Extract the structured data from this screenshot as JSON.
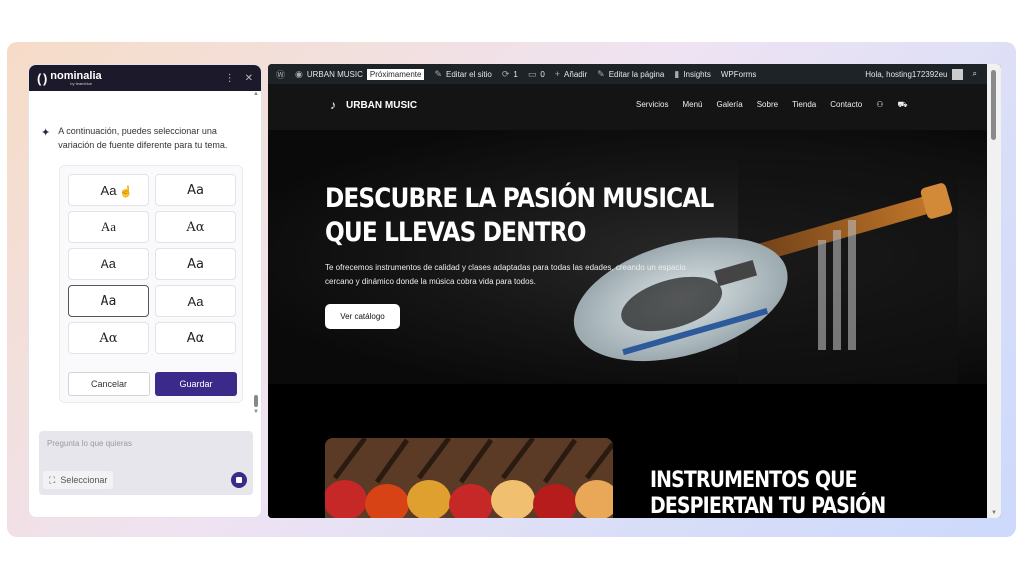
{
  "panel": {
    "brand": "nominalia",
    "brand_sub": "by teamblue",
    "menu_icon": "more-vertical-icon",
    "close_icon": "close-icon",
    "hint": "A continuación, puedes seleccionar una variación de fuente diferente para tu tema.",
    "font_options": [
      "Aa",
      "Aa",
      "Aa",
      "Aα",
      "Aa",
      "Aa",
      "Aa",
      "Aa",
      "Aα",
      "Aα"
    ],
    "selected_index": 6,
    "cancel_label": "Cancelar",
    "save_label": "Guardar",
    "chat_placeholder": "Pregunta lo que quieras",
    "select_label": "Seleccionar"
  },
  "adminbar": {
    "site_name": "URBAN MUSIC",
    "badge": "Próximamente",
    "edit_site": "Editar el sitio",
    "updates": "1",
    "comments": "0",
    "add": "Añadir",
    "edit_page": "Editar la página",
    "insights": "Insights",
    "wpforms": "WPForms",
    "greeting": "Hola, hosting172392eu"
  },
  "site": {
    "brand": "URBAN MUSIC",
    "menu": [
      "Servicios",
      "Menú",
      "Galería",
      "Sobre",
      "Tienda",
      "Contacto"
    ],
    "hero_title_1": "DESCUBRE LA PASIÓN MUSICAL",
    "hero_title_2": "QUE LLEVAS DENTRO",
    "hero_text": "Te ofrecemos instrumentos de calidad y clases adaptadas para todas las edades, creando un espacio cercano y dinámico donde la música cobra vida para todos.",
    "cta": "Ver catálogo",
    "sec2_title_1": "INSTRUMENTOS QUE",
    "sec2_title_2": "DESPIERTAN TU PASIÓN"
  },
  "colors": {
    "accent": "#3b2a8a",
    "panel_header": "#1c1a2a",
    "adminbar": "#1d2327"
  }
}
